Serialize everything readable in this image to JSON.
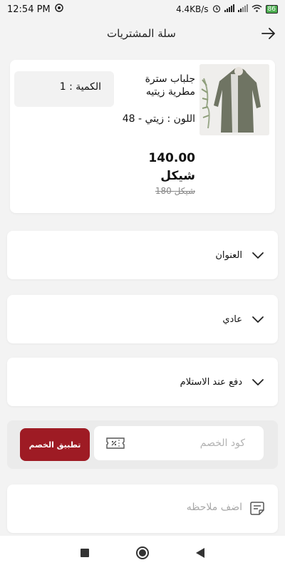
{
  "status_bar": {
    "time": "12:54 PM",
    "network_speed": "4.4KB/s",
    "battery": "86",
    "signal": "4G"
  },
  "header": {
    "title": "سلة المشتريات",
    "back_icon": "arrow-right-icon"
  },
  "cart_item": {
    "name": "جلباب سترة مطرية زيتيه",
    "color_size": "اللون : زيتي - 48",
    "quantity": "الكمية : 1",
    "price": "140.00 شيكل",
    "old_price": "180 شيكل",
    "image_icon": "jacket-photo"
  },
  "sections": {
    "address": "العنوان",
    "shipping": "عادي",
    "payment": "دفع عند الاستلام"
  },
  "discount": {
    "placeholder": "كود الخصم",
    "apply_label": "تطبيق الخصم",
    "accent": "#9e1b24"
  },
  "note": {
    "placeholder": "اضف ملاحظه"
  },
  "nav": {
    "icons": [
      "recent-apps-icon",
      "home-icon",
      "back-icon"
    ]
  }
}
